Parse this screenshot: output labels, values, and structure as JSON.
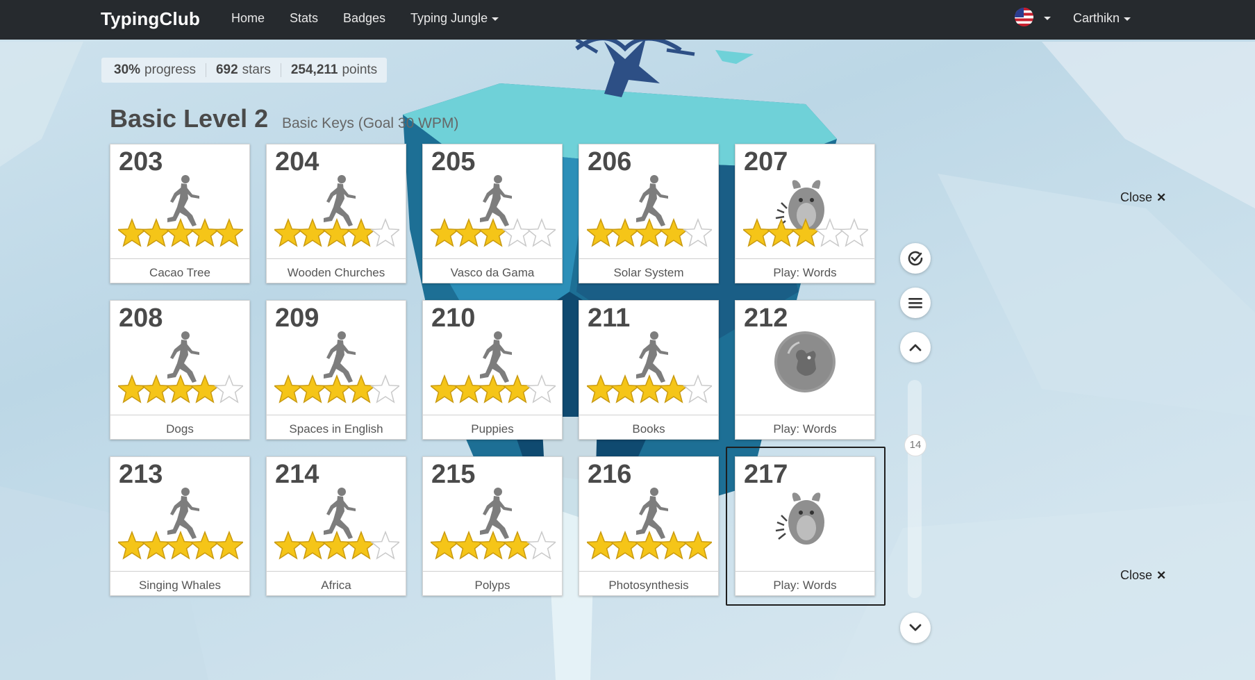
{
  "navbar": {
    "brand": "TypingClub",
    "links": [
      "Home",
      "Stats",
      "Badges",
      "Typing Jungle"
    ],
    "user": "Carthikn",
    "flag_icon": "us-flag-icon"
  },
  "stats": {
    "progress_value": "30%",
    "progress_label": "progress",
    "stars_value": "692",
    "stars_label": "stars",
    "points_value": "254,211",
    "points_label": "points"
  },
  "level": {
    "title": "Basic Level 2",
    "subtitle": "Basic Keys (Goal 30 WPM)"
  },
  "lessons": [
    {
      "number": "203",
      "name": "Cacao Tree",
      "type": "runner",
      "stars": 5
    },
    {
      "number": "204",
      "name": "Wooden Churches",
      "type": "runner",
      "stars": 4
    },
    {
      "number": "205",
      "name": "Vasco da Gama",
      "type": "runner",
      "stars": 3
    },
    {
      "number": "206",
      "name": "Solar System",
      "type": "runner",
      "stars": 4
    },
    {
      "number": "207",
      "name": "Play: Words",
      "type": "monster",
      "stars": 3
    },
    {
      "number": "208",
      "name": "Dogs",
      "type": "runner",
      "stars": 4
    },
    {
      "number": "209",
      "name": "Spaces in English",
      "type": "runner",
      "stars": 4
    },
    {
      "number": "210",
      "name": "Puppies",
      "type": "runner",
      "stars": 4
    },
    {
      "number": "211",
      "name": "Books",
      "type": "runner",
      "stars": 4
    },
    {
      "number": "212",
      "name": "Play: Words",
      "type": "bubble",
      "stars": null
    },
    {
      "number": "213",
      "name": "Singing Whales",
      "type": "runner",
      "stars": 5
    },
    {
      "number": "214",
      "name": "Africa",
      "type": "runner",
      "stars": 4
    },
    {
      "number": "215",
      "name": "Polyps",
      "type": "runner",
      "stars": 4
    },
    {
      "number": "216",
      "name": "Photosynthesis",
      "type": "runner",
      "stars": 5
    },
    {
      "number": "217",
      "name": "Play: Words",
      "type": "monster",
      "stars": null
    }
  ],
  "selected_lesson": "217",
  "side_controls": {
    "check_icon": "check-circle-icon",
    "menu_icon": "hamburger-menu-icon",
    "up_icon": "chevron-up-icon",
    "down_icon": "chevron-down-icon",
    "scroll_position": "14"
  },
  "close_top": "Close",
  "close_bottom": "Close",
  "colors": {
    "navbar": "#262a2e",
    "star_gold": "#f5c518",
    "text_dark": "#4a4a4a"
  }
}
